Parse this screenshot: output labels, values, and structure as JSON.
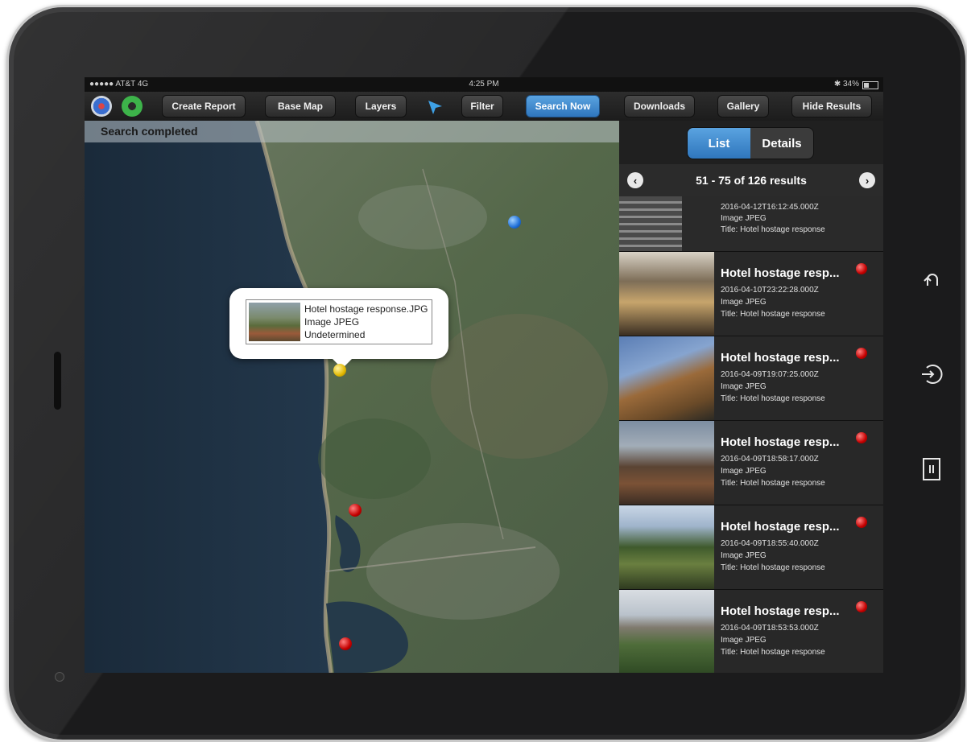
{
  "status": {
    "carrier": "●●●●● AT&T  4G",
    "time": "4:25 PM",
    "battery": "✱ 34%"
  },
  "toolbar": {
    "create_report": "Create Report",
    "base_map": "Base Map",
    "layers": "Layers",
    "filter": "Filter",
    "search_now": "Search Now",
    "downloads": "Downloads",
    "gallery": "Gallery",
    "hide_results": "Hide Results"
  },
  "map": {
    "banner": "Search completed",
    "callout": {
      "title": "Hotel hostage response.JPG",
      "type": "Image JPEG",
      "classification": "Undetermined"
    }
  },
  "panel": {
    "tab_list": "List",
    "tab_details": "Details",
    "pager": "51 - 75 of 126 results",
    "results": [
      {
        "title": "",
        "date": "2016-04-12T16:12:45.000Z",
        "type": "Image JPEG",
        "subtitle": "Title: Hotel hostage response"
      },
      {
        "title": "Hotel hostage resp...",
        "date": "2016-04-10T23:22:28.000Z",
        "type": "Image JPEG",
        "subtitle": "Title: Hotel hostage response"
      },
      {
        "title": "Hotel hostage resp...",
        "date": "2016-04-09T19:07:25.000Z",
        "type": "Image JPEG",
        "subtitle": "Title: Hotel hostage response"
      },
      {
        "title": "Hotel hostage resp...",
        "date": "2016-04-09T18:58:17.000Z",
        "type": "Image JPEG",
        "subtitle": "Title: Hotel hostage response"
      },
      {
        "title": "Hotel hostage resp...",
        "date": "2016-04-09T18:55:40.000Z",
        "type": "Image JPEG",
        "subtitle": "Title: Hotel hostage response"
      },
      {
        "title": "Hotel hostage resp...",
        "date": "2016-04-09T18:53:53.000Z",
        "type": "Image JPEG",
        "subtitle": "Title: Hotel hostage response"
      }
    ]
  },
  "colors": {
    "accent": "#2f76bd",
    "pin_red": "#c40000",
    "pin_blue": "#1f6fd8",
    "pin_yellow": "#e2b800"
  },
  "icons": [
    "globe-icon",
    "gear-check-icon",
    "location-arrow-icon",
    "chevron-left-icon",
    "chevron-right-icon",
    "undo-icon",
    "logout-icon",
    "pause-icon"
  ]
}
